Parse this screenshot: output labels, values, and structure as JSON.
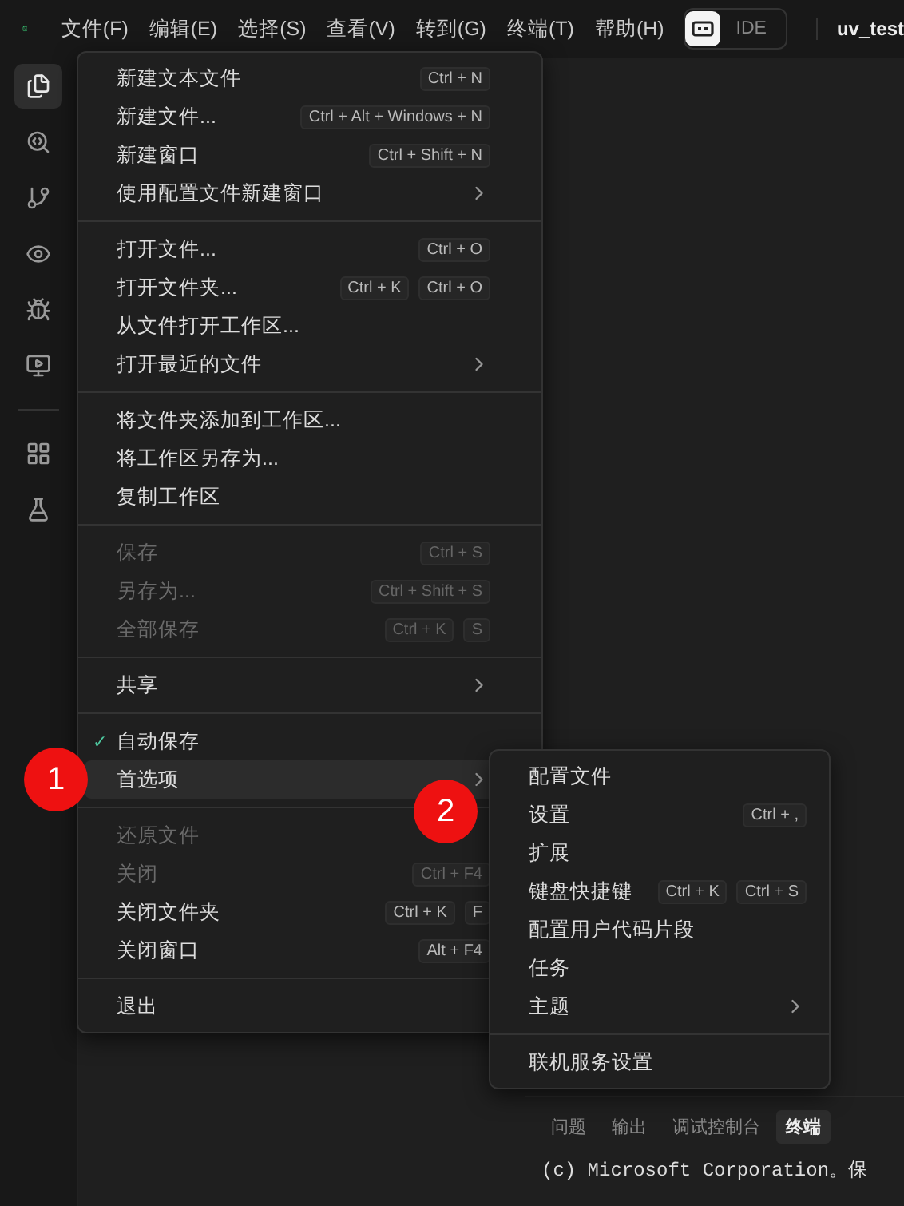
{
  "menubar": {
    "menus": [
      {
        "label": "文件(F)"
      },
      {
        "label": "编辑(E)"
      },
      {
        "label": "选择(S)"
      },
      {
        "label": "查看(V)"
      },
      {
        "label": "转到(G)"
      },
      {
        "label": "终端(T)"
      },
      {
        "label": "帮助(H)"
      }
    ],
    "mode_toggle": {
      "label": "IDE"
    },
    "title": "uv_test"
  },
  "activity_bar": [
    {
      "kind": "button",
      "selected": true
    },
    {
      "kind": "button",
      "selected": false
    },
    {
      "kind": "button",
      "selected": false
    },
    {
      "kind": "button",
      "selected": false
    },
    {
      "kind": "button",
      "selected": false
    },
    {
      "kind": "button",
      "selected": false
    },
    {
      "kind": "separator"
    },
    {
      "kind": "button",
      "selected": false
    },
    {
      "kind": "button",
      "selected": false
    }
  ],
  "file_menu": [
    {
      "kind": "item",
      "label": "新建文本文件",
      "selected": false,
      "disabled": false,
      "checked": false,
      "submenu": false,
      "chords": [
        [
          "Ctrl",
          "+",
          "N"
        ]
      ]
    },
    {
      "kind": "item",
      "label": "新建文件...",
      "selected": false,
      "disabled": false,
      "checked": false,
      "submenu": false,
      "chords": [
        [
          "Ctrl",
          "+",
          "Alt",
          "+",
          "Windows",
          "+",
          "N"
        ]
      ]
    },
    {
      "kind": "item",
      "label": "新建窗口",
      "selected": false,
      "disabled": false,
      "checked": false,
      "submenu": false,
      "chords": [
        [
          "Ctrl",
          "+",
          "Shift",
          "+",
          "N"
        ]
      ]
    },
    {
      "kind": "item",
      "label": "使用配置文件新建窗口",
      "selected": false,
      "disabled": false,
      "checked": false,
      "submenu": true
    },
    {
      "kind": "separator"
    },
    {
      "kind": "item",
      "label": "打开文件...",
      "selected": false,
      "disabled": false,
      "checked": false,
      "submenu": false,
      "chords": [
        [
          "Ctrl",
          "+",
          "O"
        ]
      ]
    },
    {
      "kind": "item",
      "label": "打开文件夹...",
      "selected": false,
      "disabled": false,
      "checked": false,
      "submenu": false,
      "chords": [
        [
          "Ctrl",
          "+",
          "K"
        ],
        [
          "Ctrl",
          "+",
          "O"
        ]
      ]
    },
    {
      "kind": "item",
      "label": "从文件打开工作区...",
      "selected": false,
      "disabled": false,
      "checked": false,
      "submenu": false
    },
    {
      "kind": "item",
      "label": "打开最近的文件",
      "selected": false,
      "disabled": false,
      "checked": false,
      "submenu": true
    },
    {
      "kind": "separator"
    },
    {
      "kind": "item",
      "label": "将文件夹添加到工作区...",
      "selected": false,
      "disabled": false,
      "checked": false,
      "submenu": false
    },
    {
      "kind": "item",
      "label": "将工作区另存为...",
      "selected": false,
      "disabled": false,
      "checked": false,
      "submenu": false
    },
    {
      "kind": "item",
      "label": "复制工作区",
      "selected": false,
      "disabled": false,
      "checked": false,
      "submenu": false
    },
    {
      "kind": "separator"
    },
    {
      "kind": "item",
      "label": "保存",
      "selected": false,
      "disabled": true,
      "checked": false,
      "submenu": false,
      "chords": [
        [
          "Ctrl",
          "+",
          "S"
        ]
      ]
    },
    {
      "kind": "item",
      "label": "另存为...",
      "selected": false,
      "disabled": true,
      "checked": false,
      "submenu": false,
      "chords": [
        [
          "Ctrl",
          "+",
          "Shift",
          "+",
          "S"
        ]
      ]
    },
    {
      "kind": "item",
      "label": "全部保存",
      "selected": false,
      "disabled": true,
      "checked": false,
      "submenu": false,
      "chords": [
        [
          "Ctrl",
          "+",
          "K"
        ],
        [
          "S"
        ]
      ]
    },
    {
      "kind": "separator"
    },
    {
      "kind": "item",
      "label": "共享",
      "selected": false,
      "disabled": false,
      "checked": false,
      "submenu": true
    },
    {
      "kind": "separator"
    },
    {
      "kind": "item",
      "label": "自动保存",
      "selected": false,
      "disabled": false,
      "checked": true,
      "check": "✓",
      "submenu": false
    },
    {
      "kind": "item",
      "label": "首选项",
      "selected": true,
      "disabled": false,
      "checked": false,
      "submenu": true,
      "marker": "1"
    },
    {
      "kind": "separator"
    },
    {
      "kind": "item",
      "label": "还原文件",
      "selected": false,
      "disabled": true,
      "checked": false,
      "submenu": false
    },
    {
      "kind": "item",
      "label": "关闭",
      "selected": false,
      "disabled": true,
      "checked": false,
      "submenu": false,
      "chords": [
        [
          "Ctrl",
          "+",
          "F4"
        ]
      ]
    },
    {
      "kind": "item",
      "label": "关闭文件夹",
      "selected": false,
      "disabled": false,
      "checked": false,
      "submenu": false,
      "chords": [
        [
          "Ctrl",
          "+",
          "K"
        ],
        [
          "F"
        ]
      ]
    },
    {
      "kind": "item",
      "label": "关闭窗口",
      "selected": false,
      "disabled": false,
      "checked": false,
      "submenu": false,
      "chords": [
        [
          "Alt",
          "+",
          "F4"
        ]
      ]
    },
    {
      "kind": "separator"
    },
    {
      "kind": "item",
      "label": "退出",
      "selected": false,
      "disabled": false,
      "checked": false,
      "submenu": false
    }
  ],
  "preferences_menu": [
    {
      "kind": "item",
      "label": "配置文件",
      "selected": false,
      "submenu": false
    },
    {
      "kind": "item",
      "label": "设置",
      "selected": false,
      "submenu": false,
      "chords": [
        [
          "Ctrl",
          "+",
          ","
        ]
      ],
      "marker": "2"
    },
    {
      "kind": "item",
      "label": "扩展",
      "selected": false,
      "submenu": false
    },
    {
      "kind": "item",
      "label": "键盘快捷键",
      "selected": false,
      "submenu": false,
      "chords": [
        [
          "Ctrl",
          "+",
          "K"
        ],
        [
          "Ctrl",
          "+",
          "S"
        ]
      ]
    },
    {
      "kind": "item",
      "label": "配置用户代码片段",
      "selected": false,
      "submenu": false
    },
    {
      "kind": "item",
      "label": "任务",
      "selected": false,
      "submenu": false
    },
    {
      "kind": "item",
      "label": "主题",
      "selected": false,
      "submenu": true
    },
    {
      "kind": "separator"
    },
    {
      "kind": "item",
      "label": "联机服务设置",
      "selected": false,
      "submenu": false
    }
  ],
  "panel": {
    "tabs": [
      {
        "label": "问题",
        "selected": false
      },
      {
        "label": "输出",
        "selected": false
      },
      {
        "label": "调试控制台",
        "selected": false
      },
      {
        "label": "终端",
        "selected": true
      }
    ],
    "terminal_line": "(c) Microsoft Corporation。保"
  }
}
